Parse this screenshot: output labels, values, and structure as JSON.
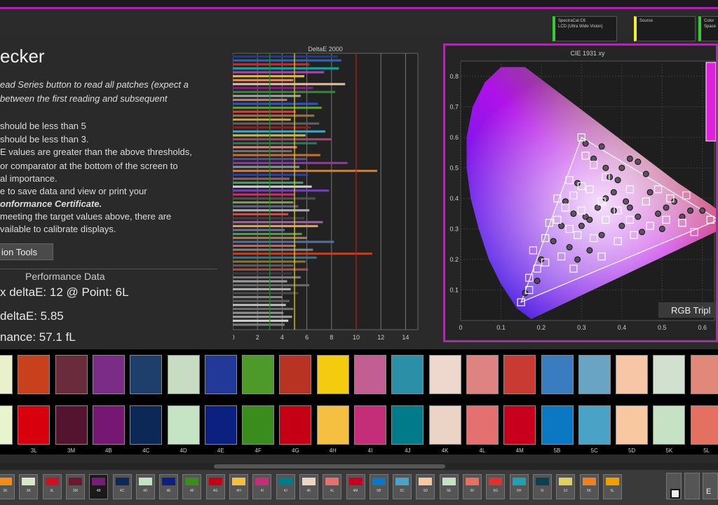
{
  "toolbar": {
    "boxes": [
      {
        "label": "SpectraCal C6",
        "sub": "LCD (Ultra Wide Vision)",
        "color": "#3c3"
      },
      {
        "label": "Source",
        "sub": "",
        "color": "#ee3"
      },
      {
        "label": "Color Space",
        "sub": "",
        "color": "#3c3"
      }
    ]
  },
  "left": {
    "title": "ecker",
    "instructions": [
      {
        "text": "ead Series button to read all patches (expect a",
        "style": "it"
      },
      {
        "text": "between the first reading and subsequent",
        "style": "it"
      },
      {
        "text": "should be less than 5",
        "style": ""
      },
      {
        "text": "should be less than 3.",
        "style": ""
      },
      {
        "text": "E values are greater than the above thresholds,",
        "style": ""
      },
      {
        "text": "or comparator at the bottom of the screen to",
        "style": ""
      },
      {
        "text": "al importance.",
        "style": ""
      },
      {
        "text": "e to save data and view or print your",
        "style": ""
      },
      {
        "text": "onformance Certificate.",
        "style": "bi"
      },
      {
        "text": "meeting the target values above, there are",
        "style": ""
      },
      {
        "text": "vailable to calibrate displays.",
        "style": ""
      }
    ],
    "tools_button": "ion Tools",
    "perf_header": "Performance Data",
    "perf_max": "x deltaE: 12   @ Point: 6L",
    "perf_avg": "deltaE: 5.85",
    "perf_lum": "nance: 57.1 fL"
  },
  "chart_data": [
    {
      "type": "bar",
      "title": "DeltaE 2000",
      "xlim": [
        0,
        15
      ],
      "xticks": [
        0,
        2,
        4,
        6,
        8,
        10,
        12,
        14
      ],
      "thresholds": [
        3,
        5,
        10
      ],
      "threshold_colors": [
        "#2a8a2a",
        "#e6d200",
        "#b02020"
      ],
      "values": [
        8.5,
        8.8,
        6.2,
        8.6,
        7.4,
        5.8,
        4.9,
        9.1,
        6.5,
        8.3,
        5.5,
        4.4,
        6.9,
        7.2,
        5.1,
        6.6,
        4.7,
        7.0,
        6.3,
        7.5,
        5.9,
        8.0,
        6.8,
        5.2,
        4.8,
        7.1,
        6.0,
        9.3,
        5.4,
        11.7,
        6.1,
        4.6,
        5.7,
        6.4,
        7.8,
        5.0,
        6.7,
        4.9,
        5.3,
        6.2,
        4.5,
        5.8,
        7.3,
        6.9,
        4.2,
        5.6,
        6.0,
        8.2,
        5.1,
        6.5,
        11.3,
        6.8,
        5.9,
        4.9,
        6.1,
        4.8,
        5.5,
        4.4,
        6.2,
        4.7,
        5.3,
        4.0,
        4.6,
        4.3,
        4.9,
        4.1,
        4.8,
        4.5,
        4.2
      ],
      "colors": [
        "#1e3a8a",
        "#2a60c0",
        "#c03030",
        "#10a0a0",
        "#b040b0",
        "#e0c020",
        "#ff8040",
        "#e0c0a0",
        "#802080",
        "#408040",
        "#a0a0a0",
        "#c08060",
        "#3050d0",
        "#60a030",
        "#d04040",
        "#a07040",
        "#d0a020",
        "#606060",
        "#902020",
        "#40a0c0",
        "#c0c040",
        "#b04070",
        "#208050",
        "#e08080",
        "#707070",
        "#c07030",
        "#5050a0",
        "#a030a0",
        "#8090a0",
        "#c08040",
        "#3040a0",
        "#906060",
        "#40a060",
        "#d0d0d0",
        "#7040c0",
        "#c03060",
        "#505050",
        "#80a040",
        "#606090",
        "#b0b0b0",
        "#c05050",
        "#404040",
        "#a060a0",
        "#e0a060",
        "#707090",
        "#609060",
        "#a08060",
        "#5070a0",
        "#d06060",
        "#808080",
        "#c04020",
        "#407080",
        "#907030",
        "#5a5a5a",
        "#a05050",
        "#3a3a3a",
        "#7a7a7a",
        "#9a9a9a",
        "#6a6a6a",
        "#b0b0b0",
        "#4a4a4a",
        "#8a8a8a",
        "#5f5f5f",
        "#c0c0c0",
        "#6f6f6f",
        "#909090",
        "#a0a0a0",
        "#d0d0d0",
        "#7f7f7f"
      ]
    },
    {
      "type": "scatter",
      "title": "CIE 1931 xy",
      "xlim": [
        0,
        0.63
      ],
      "ylim": [
        0,
        0.85
      ],
      "xticks": [
        0,
        0.1,
        0.2,
        0.3,
        0.4,
        0.5,
        0.6
      ],
      "yticks": [
        0.1,
        0.2,
        0.3,
        0.4,
        0.5,
        0.6,
        0.7,
        0.8
      ],
      "gamut_triangle": [
        [
          0.64,
          0.33
        ],
        [
          0.3,
          0.6
        ],
        [
          0.15,
          0.06
        ]
      ],
      "targets": [
        [
          0.15,
          0.06
        ],
        [
          0.17,
          0.1
        ],
        [
          0.17,
          0.14
        ],
        [
          0.19,
          0.17
        ],
        [
          0.18,
          0.23
        ],
        [
          0.21,
          0.19
        ],
        [
          0.21,
          0.27
        ],
        [
          0.22,
          0.32
        ],
        [
          0.24,
          0.33
        ],
        [
          0.26,
          0.37
        ],
        [
          0.24,
          0.4
        ],
        [
          0.28,
          0.41
        ],
        [
          0.27,
          0.46
        ],
        [
          0.3,
          0.44
        ],
        [
          0.3,
          0.6
        ],
        [
          0.31,
          0.54
        ],
        [
          0.33,
          0.51
        ],
        [
          0.32,
          0.43
        ],
        [
          0.35,
          0.39
        ],
        [
          0.36,
          0.33
        ],
        [
          0.33,
          0.27
        ],
        [
          0.35,
          0.21
        ],
        [
          0.29,
          0.28
        ],
        [
          0.39,
          0.36
        ],
        [
          0.42,
          0.33
        ],
        [
          0.47,
          0.31
        ],
        [
          0.51,
          0.33
        ],
        [
          0.55,
          0.32
        ],
        [
          0.58,
          0.29
        ],
        [
          0.62,
          0.33
        ],
        [
          0.46,
          0.39
        ],
        [
          0.52,
          0.4
        ],
        [
          0.56,
          0.41
        ],
        [
          0.49,
          0.43
        ],
        [
          0.43,
          0.28
        ],
        [
          0.39,
          0.26
        ],
        [
          0.25,
          0.21
        ],
        [
          0.28,
          0.17
        ],
        [
          0.36,
          0.47
        ],
        [
          0.42,
          0.43
        ],
        [
          0.27,
          0.3
        ],
        [
          0.3,
          0.36
        ]
      ],
      "measured": [
        [
          0.16,
          0.09
        ],
        [
          0.19,
          0.13
        ],
        [
          0.2,
          0.2
        ],
        [
          0.23,
          0.26
        ],
        [
          0.25,
          0.31
        ],
        [
          0.28,
          0.35
        ],
        [
          0.31,
          0.34
        ],
        [
          0.3,
          0.31
        ],
        [
          0.32,
          0.33
        ],
        [
          0.34,
          0.37
        ],
        [
          0.36,
          0.4
        ],
        [
          0.38,
          0.42
        ],
        [
          0.4,
          0.5
        ],
        [
          0.42,
          0.53
        ],
        [
          0.44,
          0.52
        ],
        [
          0.46,
          0.48
        ],
        [
          0.33,
          0.53
        ],
        [
          0.31,
          0.58
        ],
        [
          0.35,
          0.57
        ],
        [
          0.37,
          0.47
        ],
        [
          0.41,
          0.39
        ],
        [
          0.44,
          0.34
        ],
        [
          0.49,
          0.35
        ],
        [
          0.53,
          0.39
        ],
        [
          0.57,
          0.36
        ],
        [
          0.6,
          0.36
        ],
        [
          0.5,
          0.3
        ],
        [
          0.45,
          0.29
        ],
        [
          0.4,
          0.31
        ],
        [
          0.35,
          0.28
        ],
        [
          0.32,
          0.23
        ],
        [
          0.29,
          0.2
        ],
        [
          0.27,
          0.24
        ],
        [
          0.26,
          0.39
        ],
        [
          0.29,
          0.45
        ],
        [
          0.38,
          0.36
        ],
        [
          0.42,
          0.37
        ],
        [
          0.47,
          0.42
        ],
        [
          0.51,
          0.37
        ],
        [
          0.55,
          0.34
        ],
        [
          0.36,
          0.5
        ],
        [
          0.39,
          0.46
        ]
      ],
      "legend_label": "RGB Tripl"
    }
  ],
  "swatches": {
    "labels": [
      "3L",
      "3M",
      "4B",
      "4C",
      "4D",
      "4E",
      "4F",
      "4G",
      "4H",
      "4I",
      "4J",
      "4K",
      "4L",
      "4M",
      "5B",
      "5C",
      "5D",
      "5K",
      "5L"
    ],
    "top": [
      "#e9f0cc",
      "#c8401c",
      "#6a2b3c",
      "#7a2c87",
      "#1e3e6c",
      "#c8dcc4",
      "#22399a",
      "#4d9a2a",
      "#b83322",
      "#f5cb10",
      "#c35e92",
      "#2c8fa8",
      "#eed7cc",
      "#df8282",
      "#c83a32",
      "#3a7cc0",
      "#6aa4c4",
      "#f7c6a6",
      "#d2e0d0",
      "#e0897a"
    ],
    "bottom": [
      "#e8f4cd",
      "#d8000c",
      "#541430",
      "#761774",
      "#0c2856",
      "#c4e4c4",
      "#0c2082",
      "#3a8c1c",
      "#c60014",
      "#f5c042",
      "#c42e78",
      "#017a8a",
      "#ebd4c6",
      "#e57070",
      "#c8001e",
      "#0a78c2",
      "#4aa2c6",
      "#f8c8a0",
      "#c6e2c4",
      "#e37060"
    ]
  },
  "bottom_strip": {
    "items": [
      {
        "label": "3K",
        "color": "#f08c1c"
      },
      {
        "label": "3K",
        "color": "#d8e8c8"
      },
      {
        "label": "3L",
        "color": "#d01020"
      },
      {
        "label": "3M",
        "color": "#6a1a30"
      },
      {
        "label": "4B",
        "color": "#7a1a7a",
        "selected": true
      },
      {
        "label": "4C",
        "color": "#0c2856"
      },
      {
        "label": "4D",
        "color": "#c4e4c4"
      },
      {
        "label": "4E",
        "color": "#0c2082"
      },
      {
        "label": "4F",
        "color": "#3a8c1c"
      },
      {
        "label": "4G",
        "color": "#c60014"
      },
      {
        "label": "4H",
        "color": "#f5c042"
      },
      {
        "label": "4I",
        "color": "#c42e78"
      },
      {
        "label": "4J",
        "color": "#017a8a"
      },
      {
        "label": "4K",
        "color": "#ebd4c6"
      },
      {
        "label": "4L",
        "color": "#e57070"
      },
      {
        "label": "4M",
        "color": "#c8001e"
      },
      {
        "label": "5B",
        "color": "#0a78c2"
      },
      {
        "label": "5C",
        "color": "#4aa2c6"
      },
      {
        "label": "5D",
        "color": "#f8c8a0"
      },
      {
        "label": "5E",
        "color": "#c6e2c4"
      },
      {
        "label": "5F",
        "color": "#e37060"
      },
      {
        "label": "5G",
        "color": "#e03030"
      },
      {
        "label": "5H",
        "color": "#20a0b0"
      },
      {
        "label": "5I",
        "color": "#0c4050"
      },
      {
        "label": "5J",
        "color": "#e0d060"
      },
      {
        "label": "5K",
        "color": "#f08020"
      },
      {
        "label": "5L",
        "color": "#f0a000"
      }
    ],
    "ctrl_label": "E"
  }
}
